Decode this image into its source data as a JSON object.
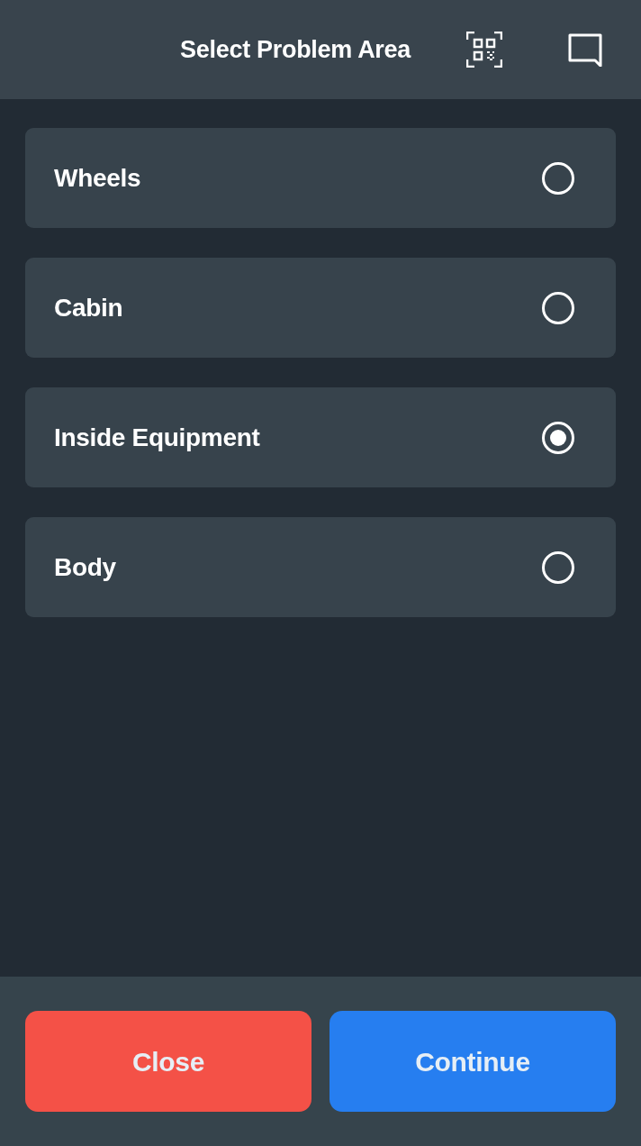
{
  "header": {
    "title": "Select Problem Area"
  },
  "options": [
    {
      "label": "Wheels",
      "selected": false
    },
    {
      "label": "Cabin",
      "selected": false
    },
    {
      "label": "Inside Equipment",
      "selected": true
    },
    {
      "label": "Body",
      "selected": false
    }
  ],
  "buttons": [
    {
      "kind": "close",
      "label": "Close"
    },
    {
      "kind": "continue",
      "label": "Continue"
    }
  ]
}
